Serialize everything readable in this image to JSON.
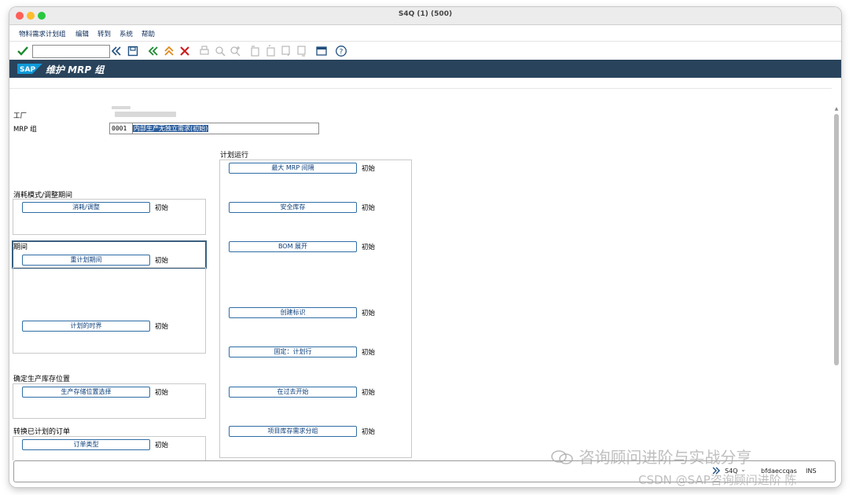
{
  "window": {
    "title": "S4Q (1) (500)"
  },
  "menu": {
    "items": [
      "物料需求计划组",
      "编辑",
      "转到",
      "系统",
      "帮助"
    ]
  },
  "toolbar": {
    "command_placeholder": "",
    "icons": [
      "check-icon",
      "back-double-icon",
      "save-icon",
      "back-green-icon",
      "exit-icon",
      "cancel-icon",
      "print-icon",
      "find-icon",
      "find-next-icon",
      "first-page-icon",
      "prev-page-icon",
      "next-page-icon",
      "last-page-icon",
      "new-window-icon",
      "help-icon"
    ]
  },
  "header": {
    "logo": "SAP",
    "title": "维护 MRP 组"
  },
  "fields": {
    "plant_label": "工厂",
    "mrp_group_label": "MRP 组",
    "mrp_group_code": "0001",
    "mrp_group_desc": "内部生产无独立需求(初始)"
  },
  "left": {
    "consumption": {
      "title": "消耗模式/调整期间",
      "button": "消耗/调整",
      "status": "初始"
    },
    "period": {
      "title": "期间",
      "replan_button": "重计划期间",
      "replan_status": "初始",
      "fence_button": "计划的时界",
      "fence_status": "初始"
    },
    "storage": {
      "title": "确定生产库存位置",
      "button": "生产存储位置选择",
      "status": "初始"
    },
    "order": {
      "title": "转换已计划的订单",
      "button": "订单类型",
      "status": "初始"
    }
  },
  "right": {
    "title": "计划运行",
    "buttons": [
      {
        "label": "最大 MRP 间隔",
        "status": "初始"
      },
      {
        "label": "安全库存",
        "status": "初始"
      },
      {
        "label": "BOM 展开",
        "status": "初始"
      },
      {
        "label": "创建标识",
        "status": "初始"
      },
      {
        "label": "固定：计划行",
        "status": "初始"
      },
      {
        "label": "在过去开始",
        "status": "初始"
      },
      {
        "label": "项目库存需求分组",
        "status": "初始"
      }
    ]
  },
  "statusbar": {
    "system": "S4Q",
    "user": "bfdaeccqas",
    "mode": "INS"
  },
  "watermark": {
    "line1": "咨询顾问进阶与实战分享",
    "line2": "CSDN @SAP咨询顾问进阶 陈"
  },
  "colors": {
    "header_bg": "#29435c",
    "button_border": "#2f6ea5",
    "check_green": "#1c8a2e",
    "cancel_red": "#cc1f1f"
  }
}
